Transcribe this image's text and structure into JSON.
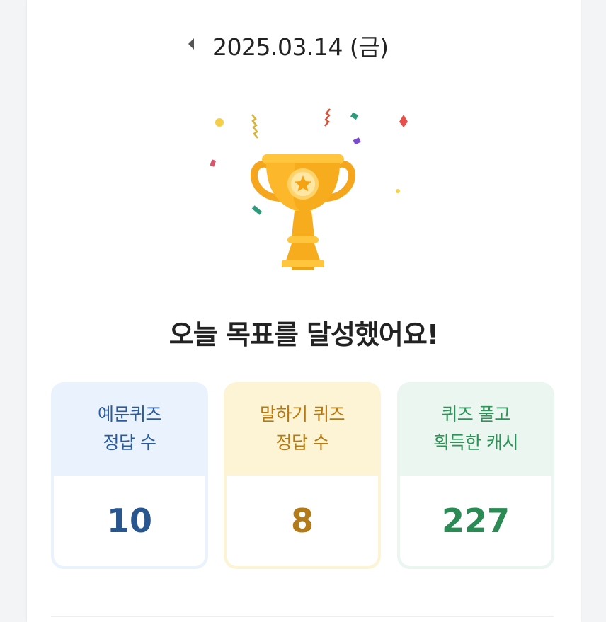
{
  "header": {
    "date": "2025.03.14 (금)",
    "prev_icon": "caret-left-icon"
  },
  "hero": {
    "icon": "trophy-icon",
    "headline": "오늘 목표를 달성했어요!"
  },
  "stats": [
    {
      "line1": "예문퀴즈",
      "line2": "정답 수",
      "value": "10",
      "accent": "#2b5b9c"
    },
    {
      "line1": "말하기 퀴즈",
      "line2": "정답 수",
      "value": "8",
      "accent": "#b87a10"
    },
    {
      "line1": "퀴즈 풀고",
      "line2": "획득한 캐시",
      "value": "227",
      "accent": "#2e9359"
    }
  ],
  "colors": {
    "trophy_gold": "#f7a81b",
    "trophy_light": "#ffc63d",
    "blue_card_bg": "#eaf3fd",
    "yellow_card_bg": "#fdf4d6",
    "green_card_bg": "#eaf6ef"
  }
}
